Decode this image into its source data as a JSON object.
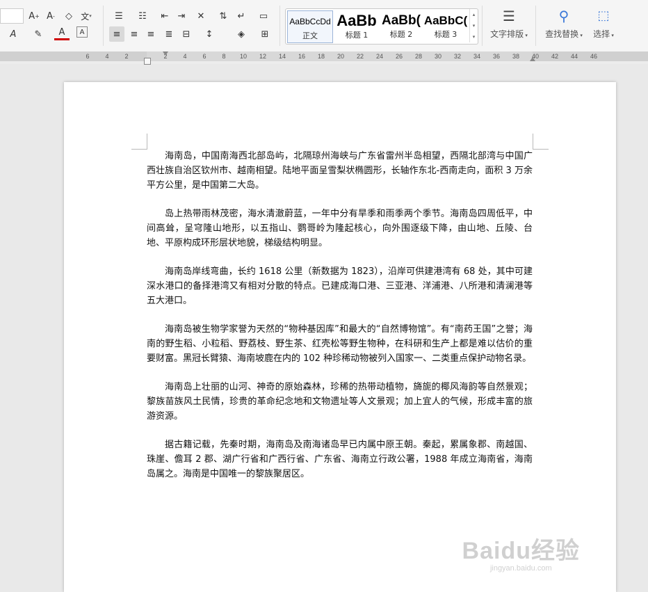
{
  "styles": [
    {
      "preview": "AaBbCcDd",
      "name": "正文",
      "selected": true
    },
    {
      "preview": "AaBb",
      "name": "标题 1",
      "selected": false
    },
    {
      "preview": "AaBb(",
      "name": "标题 2",
      "selected": false
    },
    {
      "preview": "AaBbC(",
      "name": "标题 3",
      "selected": false
    }
  ],
  "toolbar": {
    "text_layout_label": "文字排版",
    "find_replace_label": "查找替换",
    "select_label": "选择"
  },
  "ruler": {
    "ticks": [
      "6",
      "4",
      "2",
      "",
      "2",
      "4",
      "6",
      "8",
      "10",
      "12",
      "14",
      "16",
      "18",
      "20",
      "22",
      "24",
      "26",
      "28",
      "30",
      "32",
      "34",
      "36",
      "38",
      "40",
      "42",
      "44",
      "46"
    ]
  },
  "document": {
    "paragraphs": [
      "海南岛，中国南海西北部岛屿，北隔琼州海峡与广东省雷州半岛相望，西隔北部湾与中国广西壮族自治区钦州市、越南相望。陆地平面呈雪梨状椭圆形，长轴作东北-西南走向，面积 3 万余平方公里，是中国第二大岛。",
      "岛上热带雨林茂密，海水清澈蔚蓝，一年中分有旱季和雨季两个季节。海南岛四周低平，中间高耸，呈穹隆山地形，以五指山、鹦哥岭为隆起核心，向外围逐级下降，由山地、丘陵、台地、平原构成环形层状地貌，梯级结构明显。",
      "海南岛岸线弯曲，长约 1618 公里（新数据为 1823），沿岸可供建港湾有 68 处，其中可建深水港口的备择港湾又有相对分散的特点。已建成海口港、三亚港、洋浦港、八所港和清澜港等五大港口。",
      "海南岛被生物学家誉为天然的“物种基因库”和最大的“自然博物馆”。有“南药王国”之誉；海南的野生稻、小粒稻、野荔枝、野生茶、红壳松等野生物种，在科研和生产上都是难以估价的重要财富。黑冠长臂猿、海南坡鹿在内的 102 种珍稀动物被列入国家一、二类重点保护动物名录。",
      "海南岛上壮丽的山河、神奇的原始森林，珍稀的热带动植物，旖旎的椰风海韵等自然景观；黎族苗族风土民情，珍贵的革命纪念地和文物遗址等人文景观；加上宜人的气候，形成丰富的旅游资源。",
      "据古籍记载，先秦时期，海南岛及南海诸岛早已内属中原王朝。秦起，累属象郡、南越国、珠崖、儋耳 2 郡、湖广行省和广西行省、广东省、海南立行政公署，1988 年成立海南省，海南岛属之。海南是中国唯一的黎族聚居区。"
    ]
  },
  "watermark": {
    "main": "Baidu经验",
    "sub": "jingyan.baidu.com"
  }
}
